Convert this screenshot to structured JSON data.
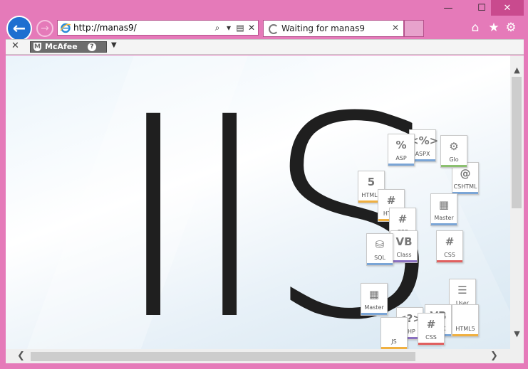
{
  "window": {
    "minimize_glyph": "—",
    "maximize_glyph": "☐",
    "close_glyph": "✕"
  },
  "nav": {
    "back_glyph": "←",
    "forward_glyph": "→"
  },
  "address_bar": {
    "url": "http://manas9/",
    "search_glyph": "⌕",
    "dropdown_glyph": "▾",
    "compat_glyph": "▤",
    "stop_glyph": "✕"
  },
  "tab": {
    "title": "Waiting for manas9",
    "close_glyph": "✕"
  },
  "top_icons": {
    "home": "⌂",
    "favorites": "★",
    "tools": "⚙"
  },
  "toolbar": {
    "close_glyph": "✕",
    "mcafee_label": "McAfee",
    "help_glyph": "?",
    "menu_glyph": "▼"
  },
  "page": {
    "headline": "IIS",
    "files": [
      {
        "label": "ASPX",
        "glyph": "<%>",
        "color": "#7aa5d6"
      },
      {
        "label": "CSHTML",
        "glyph": "@",
        "color": "#7aa5d6"
      },
      {
        "label": "HTML5",
        "glyph": "5",
        "color": "#f0b040"
      },
      {
        "label": "HTML",
        "glyph": "#",
        "color": "#f0b040"
      },
      {
        "label": "CSS",
        "glyph": "#",
        "color": "#e06060"
      },
      {
        "label": "Class",
        "glyph": "VB",
        "color": "#8a70c0"
      },
      {
        "label": "Master",
        "glyph": "▦",
        "color": "#7aa5d6"
      },
      {
        "label": "CSS",
        "glyph": "#",
        "color": "#e06060"
      },
      {
        "label": "SQL",
        "glyph": "⛁",
        "color": "#7aa5d6"
      },
      {
        "label": "User",
        "glyph": "☰",
        "color": "#7aa5d6"
      },
      {
        "label": "Master",
        "glyph": "▦",
        "color": "#7aa5d6"
      },
      {
        "label": "PHP",
        "glyph": "<?>",
        "color": "#8a70c0"
      },
      {
        "label": "ASPX",
        "glyph": "VB",
        "color": "#7aa5d6"
      },
      {
        "label": "HTML5",
        "glyph": "",
        "color": "#f0b040"
      },
      {
        "label": "CSS",
        "glyph": "#",
        "color": "#e06060"
      },
      {
        "label": "Glo",
        "glyph": "⚙",
        "color": "#8cc070"
      },
      {
        "label": "ASP",
        "glyph": "%",
        "color": "#7aa5d6"
      },
      {
        "label": "JS",
        "glyph": "",
        "color": "#f0b040"
      }
    ]
  },
  "scroll": {
    "up": "▲",
    "down": "▼",
    "left": "❮",
    "right": "❯"
  }
}
